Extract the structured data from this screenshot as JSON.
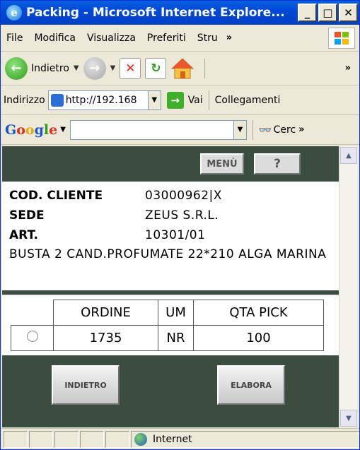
{
  "window": {
    "title": "Packing - Microsoft Internet Explore..."
  },
  "menu": {
    "items": [
      "File",
      "Modifica",
      "Visualizza",
      "Preferiti",
      "Stru"
    ]
  },
  "toolbar": {
    "back_label": "Indietro"
  },
  "address": {
    "label": "Indirizzo",
    "url": "http://192.168",
    "go_label": "Vai",
    "links_label": "Collegamenti"
  },
  "google": {
    "logo": "Google",
    "search_value": "",
    "cerca_label": "Cerc"
  },
  "page": {
    "menu_button": "MENÙ",
    "help_button": "?",
    "fields": [
      {
        "label": "COD. CLIENTE",
        "value": "03000962|X"
      },
      {
        "label": "SEDE",
        "value": "ZEUS S.R.L."
      },
      {
        "label": "ART.",
        "value": "10301/01"
      }
    ],
    "description": "BUSTA 2 CAND.PROFUMATE 22*210 ALGA MARINA",
    "table": {
      "headers": [
        "ORDINE",
        "UM",
        "QTA PICK"
      ],
      "rows": [
        {
          "ordine": "1735",
          "um": "NR",
          "qta_pick": "100"
        }
      ]
    },
    "back_button": "INDIETRO",
    "process_button": "ELABORA"
  },
  "status": {
    "zone": "Internet"
  },
  "colors": {
    "page_bg": "#3b4d40",
    "title_bar": "#0054e3"
  }
}
